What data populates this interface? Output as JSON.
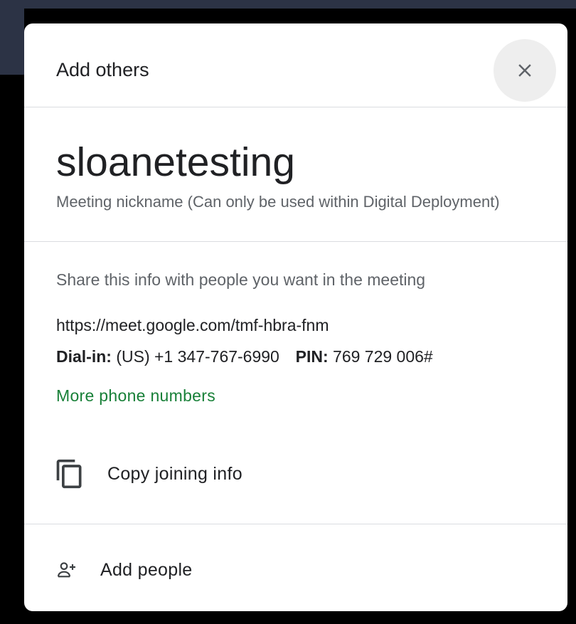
{
  "dialog": {
    "title": "Add others",
    "close_icon": "close-icon"
  },
  "meeting": {
    "nickname": "sloanetesting",
    "nickname_caption": "Meeting nickname (Can only be used within Digital Deployment)",
    "share_hint": "Share this info with people you want in the meeting",
    "link": "https://meet.google.com/tmf-hbra-fnm",
    "dialin_label": "Dial-in:",
    "dialin_number": "(US) +1 347-767-6990",
    "pin_label": "PIN:",
    "pin_value": "769 729 006#",
    "more_numbers": "More phone numbers"
  },
  "actions": {
    "copy_label": "Copy joining info",
    "copy_icon": "copy-icon",
    "add_label": "Add people",
    "add_icon": "add-person-icon"
  },
  "colors": {
    "link_green": "#188038",
    "text_primary": "#202124",
    "text_secondary": "#5f6368",
    "backdrop": "#2c3345"
  }
}
